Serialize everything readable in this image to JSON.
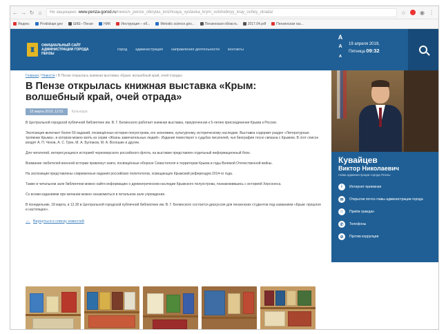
{
  "browser": {
    "secure_label": "Не защищено",
    "domain": "www.penza-gorod.ru",
    "path": "/news/v_penze_otkrylas_knizhnaya_vystavka_krym_volshebnyy_kray_ochey_otrada/",
    "bookmarks": [
      "Яндекс",
      "Prodiskapr.gov",
      "ШКЕ– Пензе",
      "НИК",
      "Инструкция – об...",
      "Metodic sсience.gov...",
      "Пензенская область",
      "2017.04.pdf",
      "Пензенская газ..."
    ]
  },
  "site": {
    "logo_text": "ОФИЦИАЛЬНЫЙ САЙТ АДМИНИСТРАЦИИ ГОРОДА ПЕНЗЫ",
    "nav": [
      "город",
      "администрация",
      "направления деятельности",
      "контакты"
    ],
    "font_ctrl": [
      "A",
      "A",
      "A"
    ],
    "date": "19 апреля 2019,",
    "time_prefix": "Пятница",
    "time": "09:32"
  },
  "article": {
    "breadcrumb": [
      "Главная",
      "Новости"
    ],
    "breadcrumb_tail": "В Пензе открылась книжная выставка «Крым: волшебный край, очей отрада»",
    "title": "В Пензе открылась книжная выставка «Крым: волшебный край, очей отрада»",
    "date": "15 марта 2019, 12:51",
    "rubric": "Культура",
    "paragraphs": [
      "В Центральной городской публичной библиотеке им. В. Г. Белинского работает книжная выставка, приуроченная к 5-летию присоединения Крыма к России.",
      "Экспозиция включает более 50 изданий, посвящённых истории полуострова, его экономике, культурному, историческому наследию. Выставка содержит раздел «Литературные тропинки Крыма», в котором можно взять из серии «Жизнь замечательных людей». Издания повествуют о судьбах писателей, чья биография тесно связана с Крымом. В этот список входят А. П. Чехов, А. С. Грин, М. А. Булгаков, М. А. Волошин и другие.",
      "Для читателей, интересующихся историей черноморского российского флота, на выставке представлен отдельный информационный блок.",
      "Внимание любителей военной истории привлекут книги, посвящённые обороне Севастополя и территории Крыма в годы Великой Отечественной войны.",
      "На экспозиции представлены современные издания российских политологов, освещающих Крымский референдум 2014-го года.",
      "Также в читальном зале библиотеки можно найти информацию о древнегреческом наследии Крымского полуострова, познакомившись с историей Херсонеса.",
      "Со всеми изданиями при желании можно ознакомиться в читальном зале учреждения.",
      "В понедельник, 18 марта, в 12.30 в Центральной городской публичной библиотеке им. В. Г. Белинского состоится дискуссия для пензенских студентов под названием «Крым: прошлое и настоящее»."
    ],
    "back_link": "Вернуться к списку новостей"
  },
  "sidebar": {
    "name": "Кувайцев",
    "patronymic": "Виктор Николаевич",
    "position": "глава администрации города Пензы",
    "links": [
      {
        "icon": "i",
        "label": "Интернет-приемная"
      },
      {
        "icon": "✉",
        "label": "Открытая почта главы администрации города"
      },
      {
        "icon": "☺",
        "label": "Приём граждан"
      },
      {
        "icon": "✆",
        "label": "Телефоны"
      },
      {
        "icon": "⊘",
        "label": "Против коррупции"
      }
    ]
  },
  "colors": {
    "header": "#1f5f95",
    "accent_gold": "#e4b623",
    "link": "#3a7dbb"
  }
}
